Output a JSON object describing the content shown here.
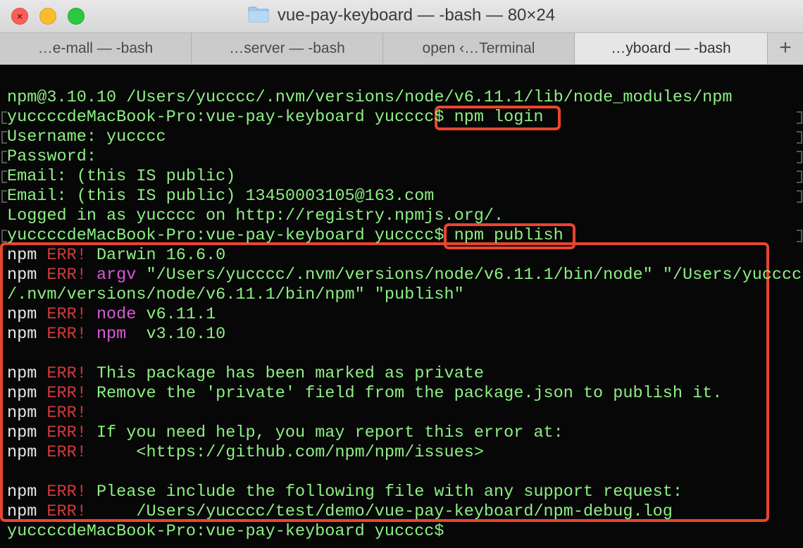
{
  "window": {
    "title": "vue-pay-keyboard — -bash — 80×24",
    "folder_icon": "folder-icon"
  },
  "tabs": [
    {
      "label": "…e-mall — -bash",
      "active": false
    },
    {
      "label": "…server — -bash",
      "active": false
    },
    {
      "label": "open ‹…Terminal",
      "active": false
    },
    {
      "label": "…yboard — -bash",
      "active": true
    }
  ],
  "new_tab_label": "+",
  "colors": {
    "text_green": "#8df083",
    "err_red": "#d13a3a",
    "keyword_magenta": "#d85ad8",
    "highlight_box": "#e8452f"
  },
  "terminal": {
    "lines": [
      [
        {
          "t": "npm@3.10.10 /Users/yucccc/.nvm/versions/node/v6.11.1/lib/node_modules/npm"
        }
      ],
      [
        {
          "t": "yuccccdeMacBook-Pro:vue-pay-keyboard yucccc$ "
        },
        {
          "t": "npm login"
        }
      ],
      [
        {
          "t": "Username: yucccc"
        }
      ],
      [
        {
          "t": "Password:"
        }
      ],
      [
        {
          "t": "Email: (this IS public)"
        }
      ],
      [
        {
          "t": "Email: (this IS public) 13450003105@163.com"
        }
      ],
      [
        {
          "t": "Logged in as yucccc on http://registry.npmjs.org/."
        }
      ],
      [
        {
          "t": "yuccccdeMacBook-Pro:vue-pay-keyboard yucccc$ "
        },
        {
          "t": "npm publish"
        }
      ],
      [
        {
          "t": "npm ",
          "c": "white"
        },
        {
          "t": "ERR!",
          "c": "red"
        },
        {
          "t": " Darwin 16.6.0"
        }
      ],
      [
        {
          "t": "npm ",
          "c": "white"
        },
        {
          "t": "ERR!",
          "c": "red"
        },
        {
          "t": " "
        },
        {
          "t": "argv",
          "c": "magenta"
        },
        {
          "t": " \"/Users/yucccc/.nvm/versions/node/v6.11.1/bin/node\" \"/Users/yucccc"
        }
      ],
      [
        {
          "t": "/.nvm/versions/node/v6.11.1/bin/npm\" \"publish\""
        }
      ],
      [
        {
          "t": "npm ",
          "c": "white"
        },
        {
          "t": "ERR!",
          "c": "red"
        },
        {
          "t": " "
        },
        {
          "t": "node",
          "c": "magenta"
        },
        {
          "t": " v6.11.1"
        }
      ],
      [
        {
          "t": "npm ",
          "c": "white"
        },
        {
          "t": "ERR!",
          "c": "red"
        },
        {
          "t": " "
        },
        {
          "t": "npm",
          "c": "magenta"
        },
        {
          "t": "  v3.10.10"
        }
      ],
      [],
      [
        {
          "t": "npm ",
          "c": "white"
        },
        {
          "t": "ERR!",
          "c": "red"
        },
        {
          "t": " This package has been marked as private"
        }
      ],
      [
        {
          "t": "npm ",
          "c": "white"
        },
        {
          "t": "ERR!",
          "c": "red"
        },
        {
          "t": " Remove the 'private' field from the package.json to publish it."
        }
      ],
      [
        {
          "t": "npm ",
          "c": "white"
        },
        {
          "t": "ERR!",
          "c": "red"
        }
      ],
      [
        {
          "t": "npm ",
          "c": "white"
        },
        {
          "t": "ERR!",
          "c": "red"
        },
        {
          "t": " If you need help, you may report this error at:"
        }
      ],
      [
        {
          "t": "npm ",
          "c": "white"
        },
        {
          "t": "ERR!",
          "c": "red"
        },
        {
          "t": "     <https://github.com/npm/npm/issues>"
        }
      ],
      [],
      [
        {
          "t": "npm ",
          "c": "white"
        },
        {
          "t": "ERR!",
          "c": "red"
        },
        {
          "t": " Please include the following file with any support request:"
        }
      ],
      [
        {
          "t": "npm ",
          "c": "white"
        },
        {
          "t": "ERR!",
          "c": "red"
        },
        {
          "t": "     /Users/yucccc/test/demo/vue-pay-keyboard/npm-debug.log"
        }
      ],
      [
        {
          "t": "yuccccdeMacBook-Pro:vue-pay-keyboard yucccc$"
        }
      ]
    ],
    "marked_lines": [
      1,
      2,
      3,
      4,
      5,
      7
    ]
  }
}
